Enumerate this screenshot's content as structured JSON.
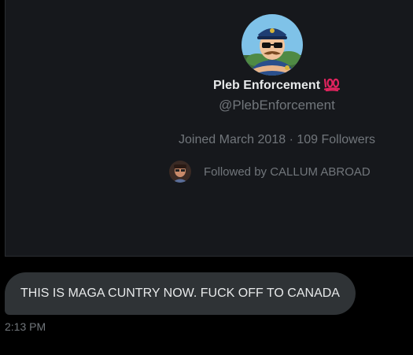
{
  "profile": {
    "display_name": "Pleb Enforcement",
    "name_emoji": "hundred-points-icon",
    "handle": "@PlebEnforcement",
    "joined": "Joined March 2018",
    "separator": " · ",
    "followers": "109 Followers",
    "followed_by": "Followed by CALLUM ABROAD"
  },
  "message": {
    "text": "THIS IS MAGA CUNTRY NOW. FUCK OFF TO CANADA",
    "timestamp": "2:13 PM"
  },
  "colors": {
    "background": "#000000",
    "card": "#16181c",
    "bubble": "#2f3336",
    "primary_text": "#e7e9ea",
    "secondary_text": "#71767b",
    "hundred_red": "#e0245e"
  }
}
